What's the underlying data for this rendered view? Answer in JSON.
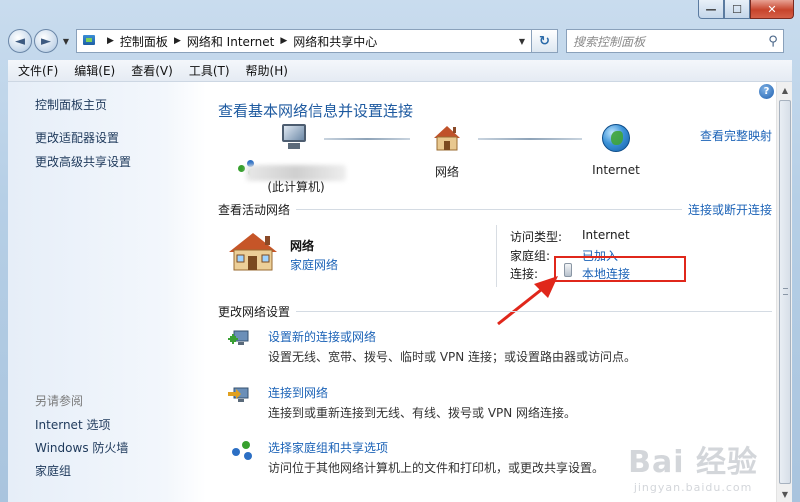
{
  "window": {
    "caption_buttons": {
      "minimize": "—",
      "maximize": "☐",
      "close": "✕"
    }
  },
  "navbar": {
    "back_glyph": "◄",
    "forward_glyph": "►",
    "breadcrumbs": [
      "控制面板",
      "网络和 Internet",
      "网络和共享中心"
    ],
    "refresh_glyph": "↻",
    "search_placeholder": "搜索控制面板"
  },
  "menu": [
    "文件(F)",
    "编辑(E)",
    "查看(V)",
    "工具(T)",
    "帮助(H)"
  ],
  "sidebar": {
    "top_links": [
      "控制面板主页",
      "更改适配器设置",
      "更改高级共享设置"
    ],
    "see_also_heading": "另请参阅",
    "see_also_links": [
      "Internet 选项",
      "Windows 防火墙",
      "家庭组"
    ]
  },
  "main": {
    "title": "查看基本网络信息并设置连接",
    "help_glyph": "?",
    "view_full_map": "查看完整映射",
    "map": {
      "computer_label": "(此计算机)",
      "network_label": "网络",
      "internet_label": "Internet"
    },
    "active_networks": {
      "heading": "查看活动网络",
      "connect_link": "连接或断开连接",
      "network_name": "网络",
      "network_type": "家庭网络",
      "access_type_label": "访问类型:",
      "access_type_value": "Internet",
      "homegroup_label": "家庭组:",
      "homegroup_value": "已加入",
      "connections_label": "连接:",
      "connections_value": "本地连接"
    },
    "change_settings": {
      "heading": "更改网络设置",
      "tasks": [
        {
          "title": "设置新的连接或网络",
          "desc": "设置无线、宽带、拨号、临时或 VPN 连接；或设置路由器或访问点。"
        },
        {
          "title": "连接到网络",
          "desc": "连接到或重新连接到无线、有线、拨号或 VPN 网络连接。"
        },
        {
          "title": "选择家庭组和共享选项",
          "desc": "访问位于其他网络计算机上的文件和打印机，或更改共享设置。"
        }
      ]
    }
  },
  "watermark": {
    "logo": "Bai 经验",
    "url": "jingyan.baidu.com"
  },
  "colors": {
    "link": "#1c63b7",
    "title": "#1e5aa0",
    "highlight": "#e0271b"
  }
}
